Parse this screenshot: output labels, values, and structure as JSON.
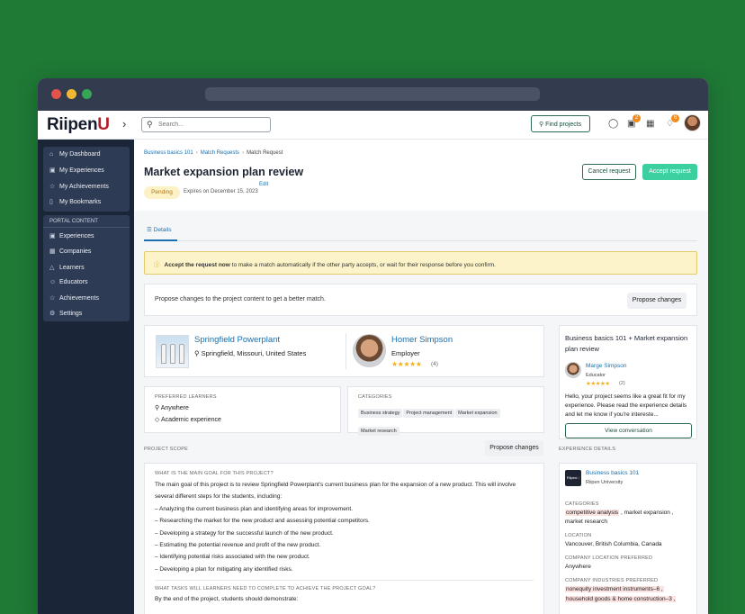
{
  "browser": {
    "dot_colors": [
      "#e2534a",
      "#f0b735",
      "#35a654"
    ]
  },
  "header": {
    "logo_main": "Riipen",
    "logo_accent": "U",
    "collapse_glyph": "›",
    "search_placeholder": "Search...",
    "find_projects_label": "Find projects",
    "icons": [
      "chat-icon",
      "inbox-icon",
      "calendar-icon",
      "bell-icon"
    ],
    "inbox_badge": "2",
    "bell_badge": "6"
  },
  "sidebar": {
    "group1": [
      {
        "label": "My Dashboard",
        "icon": "home-icon"
      },
      {
        "label": "My Experiences",
        "icon": "experiences-icon"
      },
      {
        "label": "My Achievements",
        "icon": "achievements-icon"
      },
      {
        "label": "My Bookmarks",
        "icon": "bookmark-icon"
      }
    ],
    "group2_header": "PORTAL CONTENT",
    "group2": [
      {
        "label": "Experiences",
        "icon": "experiences-icon"
      },
      {
        "label": "Companies",
        "icon": "companies-icon"
      },
      {
        "label": "Learners",
        "icon": "learners-icon"
      },
      {
        "label": "Educators",
        "icon": "educators-icon"
      },
      {
        "label": "Achievements",
        "icon": "achievements-icon"
      },
      {
        "label": "Settings",
        "icon": "gear-icon"
      }
    ]
  },
  "page": {
    "breadcrumbs": [
      "Business basics 101",
      "Match Requests",
      "Match Request"
    ],
    "title": "Market expansion plan review",
    "status": "Pending",
    "expires": "Expires on December 15, 2023",
    "edit_label": "Edit",
    "cancel_label": "Cancel request",
    "accept_label": "Accept request",
    "tab_label": "Details",
    "alert_bold": "Accept the request now",
    "alert_rest": " to make a match automatically if the other party accepts, or wait for their response before you confirm.",
    "propose_text": "Propose changes to the project content to get a better match.",
    "propose_button": "Propose changes"
  },
  "company": {
    "name": "Springfield Powerplant",
    "location": "Springfield, Missouri, United States"
  },
  "employer": {
    "name": "Homer Simpson",
    "role": "Employer",
    "stars": "★★★★★",
    "rating_count": "(4)"
  },
  "preferred_learners": {
    "heading": "PREFERRED LEARNERS",
    "items": [
      "Anywhere",
      "Academic experience"
    ]
  },
  "categories": {
    "heading": "CATEGORIES",
    "items": [
      "Business strategy",
      "Project management",
      "Market expansion",
      "Market research"
    ]
  },
  "scope": {
    "heading": "PROJECT SCOPE",
    "propose_button": "Propose changes",
    "q1": "WHAT IS THE MAIN GOAL FOR THIS PROJECT?",
    "a1": "The main goal of this project is to review Springfield Powerplant's current business plan for the expansion of a new product. This will involve several different steps for the students, including:",
    "bullets": [
      "– Analyzing the current business plan and identifying areas for improvement.",
      "– Researching the market for the new product and assessing potential competitors.",
      "– Developing a strategy for the successful launch of the new product.",
      "– Estimating the potential revenue and profit of the new product.",
      "– Identifying potential risks associated with the new product.",
      "– Developing a plan for mitigating any identified risks."
    ],
    "q2": "WHAT TASKS WILL LEARNERS NEED TO COMPLETE TO ACHIEVE THE PROJECT GOAL?",
    "a2": "By the end of the project, students should demonstrate:"
  },
  "conversation": {
    "title": "Business basics 101 + Market expansion plan review",
    "person": "Marge Simpson",
    "role": "Educator",
    "stars": "★★★★★",
    "rating_count": "(2)",
    "message": "Hello, your project seems like a great fit for my experience. Please read the experience details and let me know if you're intereste...",
    "button": "View conversation"
  },
  "experience": {
    "heading": "EXPERIENCE DETAILS",
    "name": "Business basics 101",
    "org": "Riipen University",
    "categories_label": "CATEGORIES",
    "cat1": "competitive analysis",
    "cat2": " , market expansion ,",
    "cat3": "market research",
    "location_label": "LOCATION",
    "location": "Vancouver, British Columbia, Canada",
    "company_location_label": "COMPANY LOCATION PREFERRED",
    "company_location": "Anywhere",
    "industries_label": "COMPANY INDUSTRIES PREFERRED",
    "industry1": "nonequity investment instruments–6 ,",
    "industry2": "household goods & home construction–3 ,"
  }
}
